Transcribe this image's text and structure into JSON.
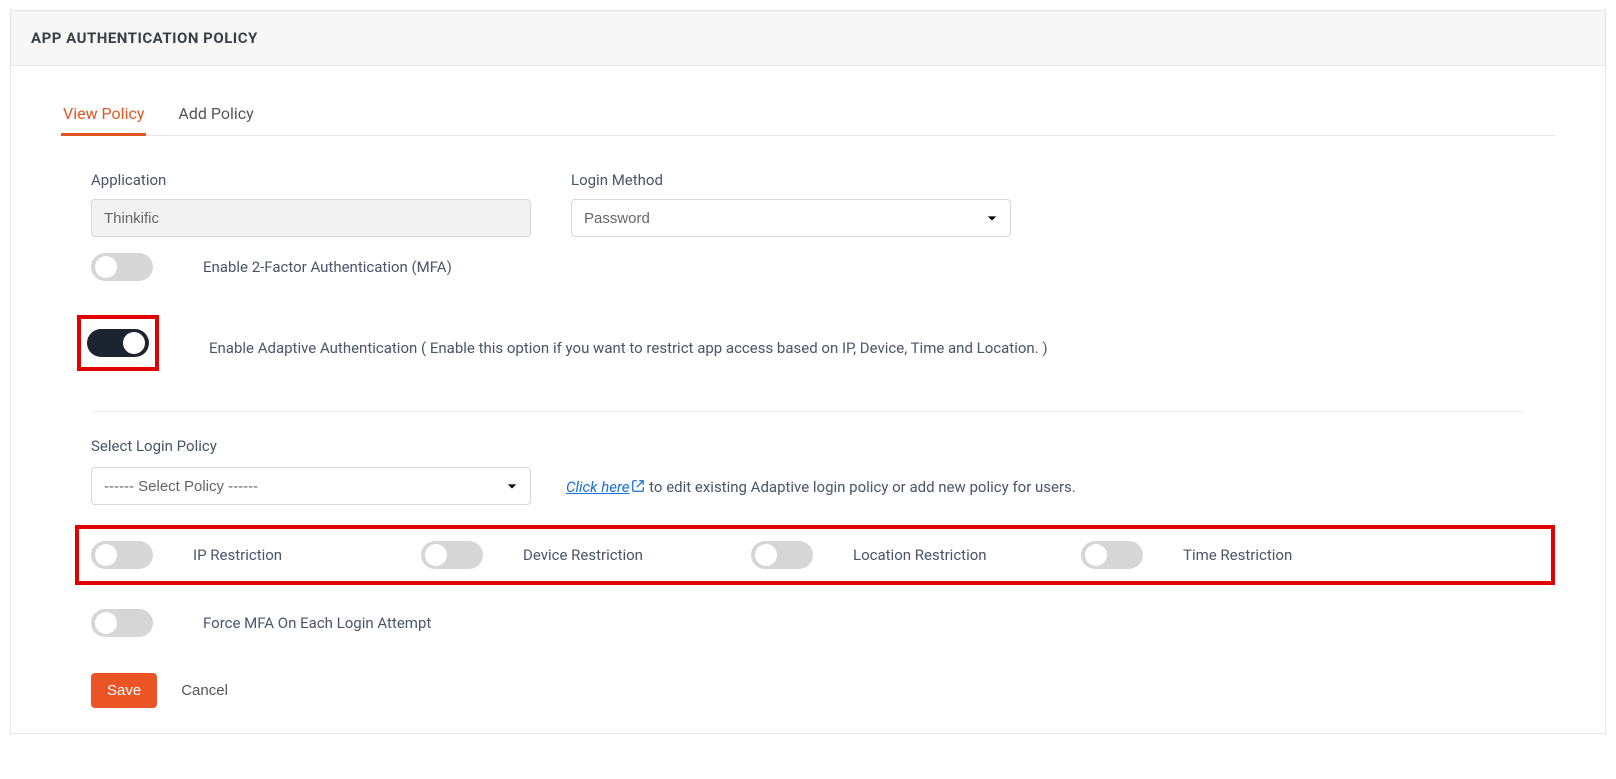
{
  "header": {
    "title": "APP AUTHENTICATION POLICY"
  },
  "tabs": {
    "view": "View Policy",
    "add": "Add Policy"
  },
  "form": {
    "application_label": "Application",
    "application_value": "Thinkific",
    "login_method_label": "Login Method",
    "login_method_value": "Password",
    "mfa_label": "Enable 2-Factor Authentication (MFA)",
    "adaptive_label": "Enable Adaptive Authentication ( Enable this option if you want to restrict app access based on IP, Device, Time and Location. )",
    "select_policy_label": "Select Login Policy",
    "select_policy_value": "------ Select Policy ------",
    "click_here": "Click here",
    "click_here_suffix": " to edit existing Adaptive login policy or add new policy for users.",
    "ip_restriction": "IP Restriction",
    "device_restriction": "Device Restriction",
    "location_restriction": "Location Restriction",
    "time_restriction": "Time Restriction",
    "force_mfa": "Force MFA On Each Login Attempt",
    "save": "Save",
    "cancel": "Cancel"
  }
}
